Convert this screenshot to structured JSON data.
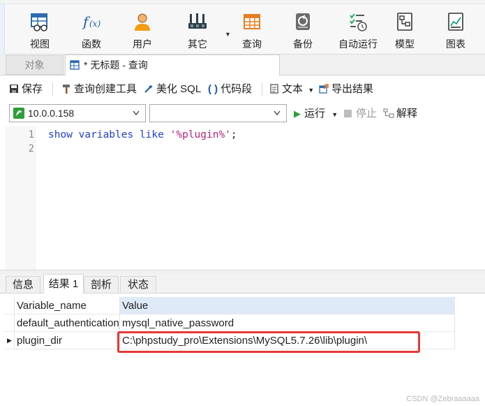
{
  "toolbar": {
    "items": [
      {
        "label": "视图",
        "icon": "table-view-icon"
      },
      {
        "label": "函数",
        "icon": "function-icon"
      },
      {
        "label": "用户",
        "icon": "user-icon"
      },
      {
        "label": "其它",
        "icon": "tools-icon"
      },
      {
        "label": "查询",
        "icon": "query-grid-icon"
      },
      {
        "label": "备份",
        "icon": "backup-icon"
      },
      {
        "label": "自动运行",
        "icon": "schedule-icon"
      },
      {
        "label": "模型",
        "icon": "model-icon"
      },
      {
        "label": "图表",
        "icon": "chart-icon"
      }
    ]
  },
  "tabs": {
    "objects_label": "对象",
    "query_label": "* 无标题 - 查询"
  },
  "query_toolbar": {
    "save": "保存",
    "builder": "查询创建工具",
    "beautify": "美化 SQL",
    "snippet": "代码段",
    "text": "文本",
    "export": "导出结果"
  },
  "connection": {
    "host": "10.0.0.158",
    "database": "",
    "run": "运行",
    "stop": "停止",
    "explain": "解释"
  },
  "editor": {
    "line_numbers": [
      "1",
      "2"
    ],
    "keyword_part": "show variables like ",
    "string_part": "'%plugin%'",
    "terminator": ";"
  },
  "result_tabs": [
    "信息",
    "结果 1",
    "剖析",
    "状态"
  ],
  "result_grid": {
    "columns": [
      "Variable_name",
      "Value"
    ],
    "rows": [
      [
        "default_authentication_plugin",
        "mysql_native_password"
      ],
      [
        "plugin_dir",
        "C:\\phpstudy_pro\\Extensions\\MySQL5.7.26\\lib\\plugin\\"
      ]
    ]
  },
  "watermark": "CSDN @Zebraaaaaa",
  "colors": {
    "keyword": "#1f3fd1",
    "string": "#b4237a",
    "run_green": "#2e9e3a",
    "highlight_red": "#e53935",
    "header_selected": "#dfeaf8"
  }
}
